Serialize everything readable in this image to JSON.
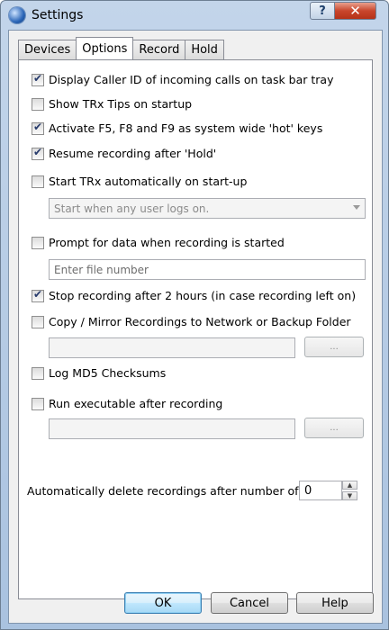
{
  "window": {
    "title": "Settings",
    "help_glyph": "?",
    "close_glyph": "✕"
  },
  "tabs": [
    {
      "label": "Devices",
      "active": false
    },
    {
      "label": "Options",
      "active": true
    },
    {
      "label": "Record",
      "active": false
    },
    {
      "label": "Hold",
      "active": false
    }
  ],
  "options": {
    "display_caller_id": {
      "label": "Display Caller ID of incoming calls on task bar tray",
      "checked": true
    },
    "show_tips": {
      "label": "Show TRx Tips on startup",
      "checked": false
    },
    "hot_keys": {
      "label": "Activate F5, F8 and F9 as system wide 'hot' keys",
      "checked": true
    },
    "resume_after_hold": {
      "label": "Resume recording after 'Hold'",
      "checked": true
    },
    "auto_start": {
      "label": "Start TRx automatically on start-up",
      "checked": false
    },
    "auto_start_mode": {
      "selected": "Start when any user logs on."
    },
    "prompt_data": {
      "label": "Prompt for data when recording is started",
      "checked": false
    },
    "file_number": {
      "placeholder": "Enter file number",
      "value": ""
    },
    "stop_after": {
      "label": "Stop recording after 2 hours (in case recording left on)",
      "checked": true
    },
    "copy_mirror": {
      "label": "Copy / Mirror Recordings to Network or Backup Folder",
      "checked": false
    },
    "copy_folder": {
      "value": "",
      "browse_label": "..."
    },
    "md5": {
      "label": "Log MD5 Checksums",
      "checked": false
    },
    "run_exe": {
      "label": "Run executable after recording",
      "checked": false
    },
    "exe_path": {
      "value": "",
      "browse_label": "..."
    },
    "auto_delete": {
      "label": "Automatically delete recordings after number of days",
      "value": "0",
      "up_glyph": "▲",
      "down_glyph": "▼"
    }
  },
  "buttons": {
    "ok": "OK",
    "cancel": "Cancel",
    "help": "Help"
  }
}
